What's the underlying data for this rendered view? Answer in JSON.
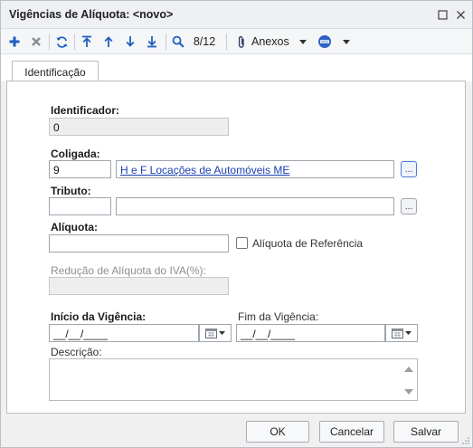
{
  "window": {
    "title": "Vigências de Alíquota: <novo>",
    "controls": {
      "maximize_icon": "maximize-icon",
      "close_icon": "close-icon"
    }
  },
  "toolbar": {
    "icons": [
      "add-icon",
      "delete-icon",
      "refresh-icon",
      "first-record-icon",
      "previous-record-icon",
      "next-record-icon",
      "last-record-icon",
      "search-icon",
      "paperclip-icon",
      "dropdown-arrow-icon",
      "database-icon",
      "dropdown-arrow-icon"
    ],
    "record_counter": "8/12",
    "attachments_label": "Anexos"
  },
  "tabs": [
    {
      "label": "Identificação",
      "active": true
    }
  ],
  "form": {
    "identificador": {
      "label": "Identificador:",
      "value": "0"
    },
    "coligada": {
      "label": "Coligada:",
      "code": "9",
      "description": "H e F Locações de Automóveis ME"
    },
    "tributo": {
      "label": "Tributo:",
      "code": "",
      "description": ""
    },
    "aliquota": {
      "label": "Alíquota:",
      "value": "",
      "ref_checkbox_label": "Alíquota de Referência",
      "ref_checked": false
    },
    "reducao": {
      "label": "Redução de Alíquota do IVA(%):",
      "value": ""
    },
    "inicio": {
      "label": "Início da Vigência:",
      "value": "__/__/____"
    },
    "fim": {
      "label": "Fim da Vigência:",
      "value": "__/__/____"
    },
    "descricao": {
      "label": "Descrição:",
      "value": ""
    }
  },
  "buttons": {
    "ok": "OK",
    "cancel": "Cancelar",
    "save": "Salvar"
  },
  "colors": {
    "accent": "#1f5fbf",
    "link": "#1a3fb0",
    "panel_border": "#b7bcc4"
  }
}
